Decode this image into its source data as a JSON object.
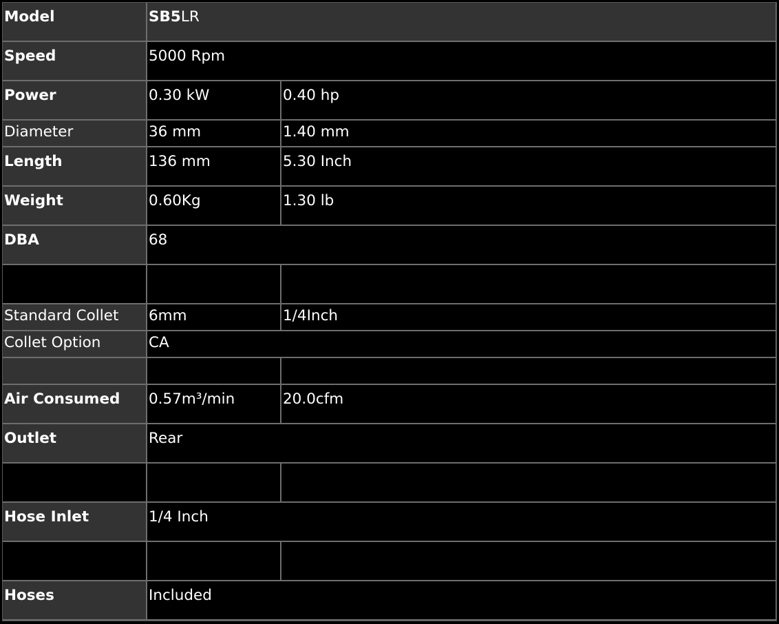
{
  "specs": {
    "rows": [
      {
        "label": "Model",
        "bold": true,
        "model_prefix": "SB5",
        "model_suffix": "LR"
      },
      {
        "label": "Speed",
        "bold": true,
        "value": "5000 Rpm"
      },
      {
        "label": "Power",
        "bold": true,
        "metric": "0.30 kW",
        "imperial": "0.40 hp"
      },
      {
        "label": "Diameter",
        "bold": false,
        "metric": "36 mm",
        "imperial": "1.40 mm"
      },
      {
        "label": "Length",
        "bold": true,
        "metric": "136 mm",
        "imperial": "5.30 Inch"
      },
      {
        "label": "Weight",
        "bold": true,
        "metric": "0.60Kg",
        "imperial": "1.30 lb"
      },
      {
        "label": "DBA",
        "bold": true,
        "value": "68"
      },
      {
        "label": "",
        "metric": "",
        "imperial": ""
      },
      {
        "label": "Standard Collet",
        "bold": false,
        "metric": "6mm",
        "imperial": "1/4Inch"
      },
      {
        "label": "Collet Option",
        "bold": false,
        "value": "CA"
      },
      {
        "label": "",
        "metric": "",
        "imperial": ""
      },
      {
        "label": "Air Consumed",
        "bold": true,
        "metric": "0.57m³/min",
        "imperial": "20.0cfm"
      },
      {
        "label": "Outlet",
        "bold": true,
        "value": "Rear"
      },
      {
        "label": "",
        "metric": "",
        "imperial": ""
      },
      {
        "label": "Hose Inlet",
        "bold": true,
        "value": "1/4 Inch"
      },
      {
        "label": "",
        "metric": "",
        "imperial": ""
      },
      {
        "label": "Hoses",
        "bold": true,
        "value": "Included"
      }
    ]
  }
}
